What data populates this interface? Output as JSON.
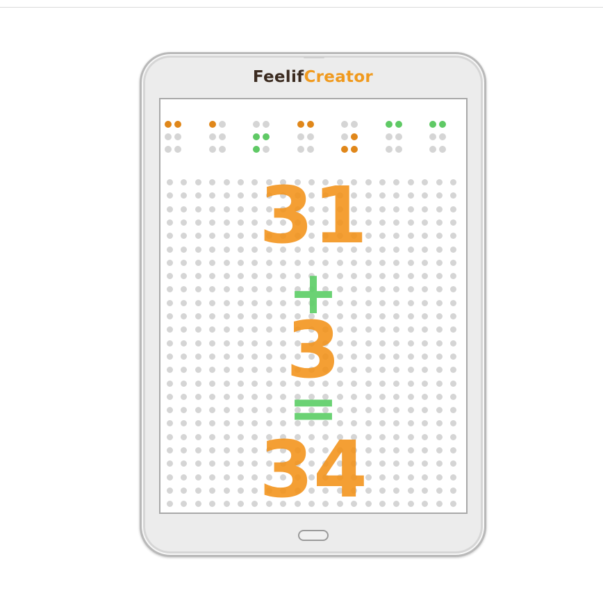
{
  "brand": {
    "part1": "Feelif",
    "part2": "Creator"
  },
  "colors": {
    "accent_orange": "#f09a1e",
    "brand_dark": "#3a2a1f",
    "braille_orange": "#e0871a",
    "braille_green": "#5fc965",
    "dot_inactive": "#d5d5d5"
  },
  "braille_cells": [
    {
      "color": "orange",
      "dots": [
        1,
        4
      ]
    },
    {
      "color": "orange",
      "dots": [
        1
      ]
    },
    {
      "color": "green",
      "dots": [
        2,
        3,
        5
      ]
    },
    {
      "color": "orange",
      "dots": [
        1,
        4
      ]
    },
    {
      "color": "orange",
      "dots": [
        5,
        6,
        3
      ]
    },
    {
      "color": "green",
      "dots": [
        1,
        4
      ]
    },
    {
      "color": "green",
      "dots": [
        1,
        4
      ]
    }
  ],
  "equation": {
    "operand1": "31",
    "operator": "+",
    "operand2": "3",
    "equals": "=",
    "result": "34"
  },
  "icons": {
    "home": "home-button-icon"
  }
}
